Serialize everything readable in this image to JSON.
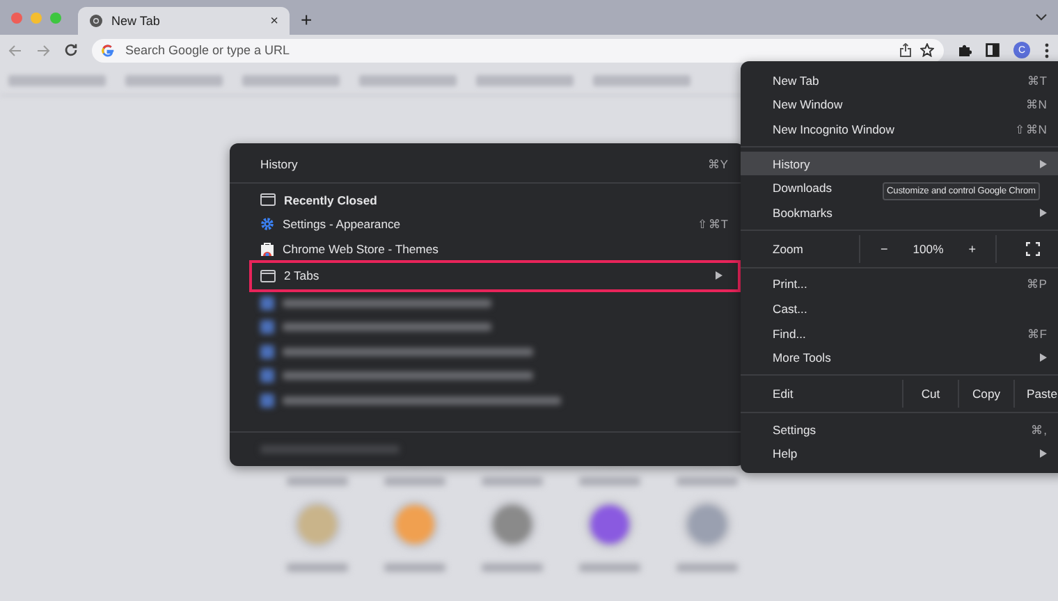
{
  "tabs": [
    {
      "title": "New Tab",
      "close": "×",
      "selected": true
    }
  ],
  "new_tab_button": "+",
  "address_bar": {
    "placeholder": "Search Google or type a URL"
  },
  "profile": {
    "initial": "C"
  },
  "history_menu": {
    "title": "History",
    "shortcut": "⌘Y",
    "items": [
      {
        "kind": "heading",
        "label": "Recently Closed"
      },
      {
        "kind": "entry",
        "label": "Settings - Appearance",
        "shortcut": "⇧⌘T"
      },
      {
        "kind": "entry",
        "label": "Chrome Web Store - Themes"
      },
      {
        "kind": "submenu",
        "label": "2 Tabs",
        "outlined": true
      }
    ]
  },
  "main_menu": [
    {
      "kind": "item",
      "label": "New Tab",
      "shortcut": "⌘T",
      "highlighted": false,
      "submenu": false
    },
    {
      "kind": "item",
      "label": "New Window",
      "shortcut": "⌘N",
      "highlighted": false,
      "submenu": false
    },
    {
      "kind": "item",
      "label": "New Incognito Window",
      "shortcut": "⇧⌘N",
      "highlighted": false,
      "submenu": false
    },
    {
      "kind": "separator"
    },
    {
      "kind": "item",
      "label": "History",
      "highlighted": true,
      "submenu": true
    },
    {
      "kind": "item",
      "label": "Downloads",
      "highlighted": false,
      "submenu": false
    },
    {
      "kind": "item",
      "label": "Bookmarks",
      "highlighted": false,
      "submenu": true
    },
    {
      "kind": "separator"
    },
    {
      "kind": "zoom",
      "label": "Zoom",
      "minus": "−",
      "value": "100%",
      "plus": "+"
    },
    {
      "kind": "separator"
    },
    {
      "kind": "item",
      "label": "Print...",
      "shortcut": "⌘P",
      "highlighted": false,
      "submenu": false
    },
    {
      "kind": "item",
      "label": "Cast...",
      "highlighted": false,
      "submenu": false
    },
    {
      "kind": "item",
      "label": "Find...",
      "shortcut": "⌘F",
      "highlighted": false,
      "submenu": false
    },
    {
      "kind": "item",
      "label": "More Tools",
      "highlighted": false,
      "submenu": true
    },
    {
      "kind": "separator"
    },
    {
      "kind": "edit",
      "label": "Edit",
      "buttons": [
        "Cut",
        "Copy",
        "Paste"
      ]
    },
    {
      "kind": "separator"
    },
    {
      "kind": "item",
      "label": "Settings",
      "shortcut": "⌘,",
      "highlighted": false,
      "submenu": false
    },
    {
      "kind": "item",
      "label": "Help",
      "highlighted": false,
      "submenu": true
    }
  ],
  "tooltip": "Customize and control Google Chrom"
}
